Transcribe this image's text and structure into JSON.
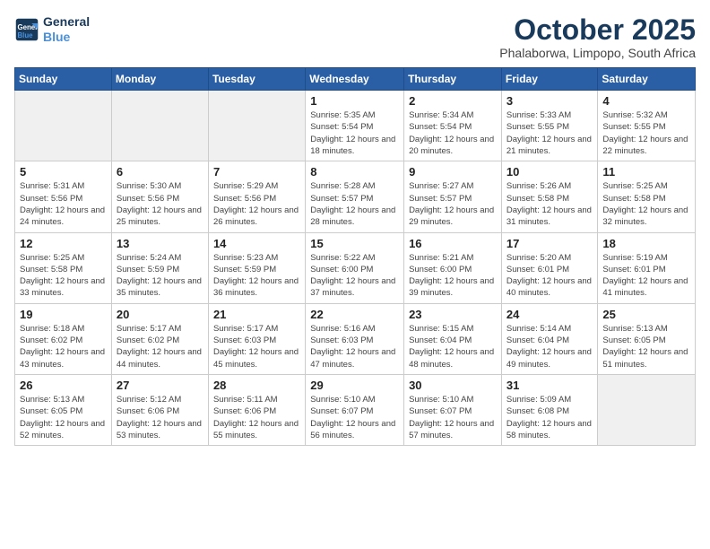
{
  "header": {
    "logo_line1": "General",
    "logo_line2": "Blue",
    "month": "October 2025",
    "location": "Phalaborwa, Limpopo, South Africa"
  },
  "weekdays": [
    "Sunday",
    "Monday",
    "Tuesday",
    "Wednesday",
    "Thursday",
    "Friday",
    "Saturday"
  ],
  "weeks": [
    [
      {
        "day": "",
        "sunrise": "",
        "sunset": "",
        "daylight": ""
      },
      {
        "day": "",
        "sunrise": "",
        "sunset": "",
        "daylight": ""
      },
      {
        "day": "",
        "sunrise": "",
        "sunset": "",
        "daylight": ""
      },
      {
        "day": "1",
        "sunrise": "Sunrise: 5:35 AM",
        "sunset": "Sunset: 5:54 PM",
        "daylight": "Daylight: 12 hours and 18 minutes."
      },
      {
        "day": "2",
        "sunrise": "Sunrise: 5:34 AM",
        "sunset": "Sunset: 5:54 PM",
        "daylight": "Daylight: 12 hours and 20 minutes."
      },
      {
        "day": "3",
        "sunrise": "Sunrise: 5:33 AM",
        "sunset": "Sunset: 5:55 PM",
        "daylight": "Daylight: 12 hours and 21 minutes."
      },
      {
        "day": "4",
        "sunrise": "Sunrise: 5:32 AM",
        "sunset": "Sunset: 5:55 PM",
        "daylight": "Daylight: 12 hours and 22 minutes."
      }
    ],
    [
      {
        "day": "5",
        "sunrise": "Sunrise: 5:31 AM",
        "sunset": "Sunset: 5:56 PM",
        "daylight": "Daylight: 12 hours and 24 minutes."
      },
      {
        "day": "6",
        "sunrise": "Sunrise: 5:30 AM",
        "sunset": "Sunset: 5:56 PM",
        "daylight": "Daylight: 12 hours and 25 minutes."
      },
      {
        "day": "7",
        "sunrise": "Sunrise: 5:29 AM",
        "sunset": "Sunset: 5:56 PM",
        "daylight": "Daylight: 12 hours and 26 minutes."
      },
      {
        "day": "8",
        "sunrise": "Sunrise: 5:28 AM",
        "sunset": "Sunset: 5:57 PM",
        "daylight": "Daylight: 12 hours and 28 minutes."
      },
      {
        "day": "9",
        "sunrise": "Sunrise: 5:27 AM",
        "sunset": "Sunset: 5:57 PM",
        "daylight": "Daylight: 12 hours and 29 minutes."
      },
      {
        "day": "10",
        "sunrise": "Sunrise: 5:26 AM",
        "sunset": "Sunset: 5:58 PM",
        "daylight": "Daylight: 12 hours and 31 minutes."
      },
      {
        "day": "11",
        "sunrise": "Sunrise: 5:25 AM",
        "sunset": "Sunset: 5:58 PM",
        "daylight": "Daylight: 12 hours and 32 minutes."
      }
    ],
    [
      {
        "day": "12",
        "sunrise": "Sunrise: 5:25 AM",
        "sunset": "Sunset: 5:58 PM",
        "daylight": "Daylight: 12 hours and 33 minutes."
      },
      {
        "day": "13",
        "sunrise": "Sunrise: 5:24 AM",
        "sunset": "Sunset: 5:59 PM",
        "daylight": "Daylight: 12 hours and 35 minutes."
      },
      {
        "day": "14",
        "sunrise": "Sunrise: 5:23 AM",
        "sunset": "Sunset: 5:59 PM",
        "daylight": "Daylight: 12 hours and 36 minutes."
      },
      {
        "day": "15",
        "sunrise": "Sunrise: 5:22 AM",
        "sunset": "Sunset: 6:00 PM",
        "daylight": "Daylight: 12 hours and 37 minutes."
      },
      {
        "day": "16",
        "sunrise": "Sunrise: 5:21 AM",
        "sunset": "Sunset: 6:00 PM",
        "daylight": "Daylight: 12 hours and 39 minutes."
      },
      {
        "day": "17",
        "sunrise": "Sunrise: 5:20 AM",
        "sunset": "Sunset: 6:01 PM",
        "daylight": "Daylight: 12 hours and 40 minutes."
      },
      {
        "day": "18",
        "sunrise": "Sunrise: 5:19 AM",
        "sunset": "Sunset: 6:01 PM",
        "daylight": "Daylight: 12 hours and 41 minutes."
      }
    ],
    [
      {
        "day": "19",
        "sunrise": "Sunrise: 5:18 AM",
        "sunset": "Sunset: 6:02 PM",
        "daylight": "Daylight: 12 hours and 43 minutes."
      },
      {
        "day": "20",
        "sunrise": "Sunrise: 5:17 AM",
        "sunset": "Sunset: 6:02 PM",
        "daylight": "Daylight: 12 hours and 44 minutes."
      },
      {
        "day": "21",
        "sunrise": "Sunrise: 5:17 AM",
        "sunset": "Sunset: 6:03 PM",
        "daylight": "Daylight: 12 hours and 45 minutes."
      },
      {
        "day": "22",
        "sunrise": "Sunrise: 5:16 AM",
        "sunset": "Sunset: 6:03 PM",
        "daylight": "Daylight: 12 hours and 47 minutes."
      },
      {
        "day": "23",
        "sunrise": "Sunrise: 5:15 AM",
        "sunset": "Sunset: 6:04 PM",
        "daylight": "Daylight: 12 hours and 48 minutes."
      },
      {
        "day": "24",
        "sunrise": "Sunrise: 5:14 AM",
        "sunset": "Sunset: 6:04 PM",
        "daylight": "Daylight: 12 hours and 49 minutes."
      },
      {
        "day": "25",
        "sunrise": "Sunrise: 5:13 AM",
        "sunset": "Sunset: 6:05 PM",
        "daylight": "Daylight: 12 hours and 51 minutes."
      }
    ],
    [
      {
        "day": "26",
        "sunrise": "Sunrise: 5:13 AM",
        "sunset": "Sunset: 6:05 PM",
        "daylight": "Daylight: 12 hours and 52 minutes."
      },
      {
        "day": "27",
        "sunrise": "Sunrise: 5:12 AM",
        "sunset": "Sunset: 6:06 PM",
        "daylight": "Daylight: 12 hours and 53 minutes."
      },
      {
        "day": "28",
        "sunrise": "Sunrise: 5:11 AM",
        "sunset": "Sunset: 6:06 PM",
        "daylight": "Daylight: 12 hours and 55 minutes."
      },
      {
        "day": "29",
        "sunrise": "Sunrise: 5:10 AM",
        "sunset": "Sunset: 6:07 PM",
        "daylight": "Daylight: 12 hours and 56 minutes."
      },
      {
        "day": "30",
        "sunrise": "Sunrise: 5:10 AM",
        "sunset": "Sunset: 6:07 PM",
        "daylight": "Daylight: 12 hours and 57 minutes."
      },
      {
        "day": "31",
        "sunrise": "Sunrise: 5:09 AM",
        "sunset": "Sunset: 6:08 PM",
        "daylight": "Daylight: 12 hours and 58 minutes."
      },
      {
        "day": "",
        "sunrise": "",
        "sunset": "",
        "daylight": ""
      }
    ]
  ]
}
